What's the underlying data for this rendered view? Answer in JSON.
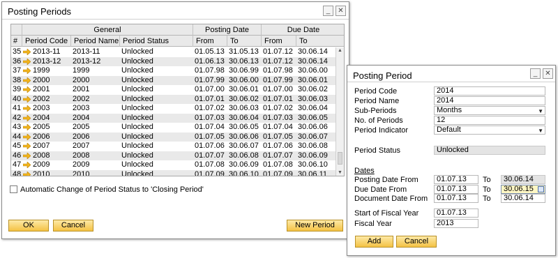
{
  "posting_periods_window": {
    "title": "Posting Periods",
    "grid": {
      "group_headers": {
        "general": "General",
        "posting_date": "Posting Date",
        "due_date": "Due Date"
      },
      "columns": {
        "num": "#",
        "period_code": "Period Code",
        "period_name": "Period Name",
        "period_status": "Period Status",
        "pd_from": "From",
        "pd_to": "To",
        "dd_from": "From",
        "dd_to": "To"
      },
      "rows": [
        {
          "num": "35",
          "code": "2013-11",
          "name": "2013-11",
          "status": "Unlocked",
          "pd_from": "01.05.13",
          "pd_to": "31.05.13",
          "dd_from": "01.07.12",
          "dd_to": "30.06.14"
        },
        {
          "num": "36",
          "code": "2013-12",
          "name": "2013-12",
          "status": "Unlocked",
          "pd_from": "01.06.13",
          "pd_to": "30.06.13",
          "dd_from": "01.07.12",
          "dd_to": "30.06.14"
        },
        {
          "num": "37",
          "code": "1999",
          "name": "1999",
          "status": "Unlocked",
          "pd_from": "01.07.98",
          "pd_to": "30.06.99",
          "dd_from": "01.07.98",
          "dd_to": "30.06.00"
        },
        {
          "num": "38",
          "code": "2000",
          "name": "2000",
          "status": "Unlocked",
          "pd_from": "01.07.99",
          "pd_to": "30.06.00",
          "dd_from": "01.07.99",
          "dd_to": "30.06.01"
        },
        {
          "num": "39",
          "code": "2001",
          "name": "2001",
          "status": "Unlocked",
          "pd_from": "01.07.00",
          "pd_to": "30.06.01",
          "dd_from": "01.07.00",
          "dd_to": "30.06.02"
        },
        {
          "num": "40",
          "code": "2002",
          "name": "2002",
          "status": "Unlocked",
          "pd_from": "01.07.01",
          "pd_to": "30.06.02",
          "dd_from": "01.07.01",
          "dd_to": "30.06.03"
        },
        {
          "num": "41",
          "code": "2003",
          "name": "2003",
          "status": "Unlocked",
          "pd_from": "01.07.02",
          "pd_to": "30.06.03",
          "dd_from": "01.07.02",
          "dd_to": "30.06.04"
        },
        {
          "num": "42",
          "code": "2004",
          "name": "2004",
          "status": "Unlocked",
          "pd_from": "01.07.03",
          "pd_to": "30.06.04",
          "dd_from": "01.07.03",
          "dd_to": "30.06.05"
        },
        {
          "num": "43",
          "code": "2005",
          "name": "2005",
          "status": "Unlocked",
          "pd_from": "01.07.04",
          "pd_to": "30.06.05",
          "dd_from": "01.07.04",
          "dd_to": "30.06.06"
        },
        {
          "num": "44",
          "code": "2006",
          "name": "2006",
          "status": "Unlocked",
          "pd_from": "01.07.05",
          "pd_to": "30.06.06",
          "dd_from": "01.07.05",
          "dd_to": "30.06.07"
        },
        {
          "num": "45",
          "code": "2007",
          "name": "2007",
          "status": "Unlocked",
          "pd_from": "01.07.06",
          "pd_to": "30.06.07",
          "dd_from": "01.07.06",
          "dd_to": "30.06.08"
        },
        {
          "num": "46",
          "code": "2008",
          "name": "2008",
          "status": "Unlocked",
          "pd_from": "01.07.07",
          "pd_to": "30.06.08",
          "dd_from": "01.07.07",
          "dd_to": "30.06.09"
        },
        {
          "num": "47",
          "code": "2009",
          "name": "2009",
          "status": "Unlocked",
          "pd_from": "01.07.08",
          "pd_to": "30.06.09",
          "dd_from": "01.07.08",
          "dd_to": "30.06.10"
        },
        {
          "num": "48",
          "code": "2010",
          "name": "2010",
          "status": "Unlocked",
          "pd_from": "01.07.09",
          "pd_to": "30.06.10",
          "dd_from": "01.07.09",
          "dd_to": "30.06.11"
        }
      ]
    },
    "auto_change_label": "Automatic Change of Period Status to 'Closing Period'",
    "ok_label": "OK",
    "cancel_label": "Cancel",
    "new_period_label": "New Period"
  },
  "posting_period_window": {
    "title": "Posting Period",
    "period_code_label": "Period Code",
    "period_code": "2014",
    "period_name_label": "Period Name",
    "period_name": "2014",
    "sub_periods_label": "Sub-Periods",
    "sub_periods": "Months",
    "no_of_periods_label": "No. of Periods",
    "no_of_periods": "12",
    "period_indicator_label": "Period Indicator",
    "period_indicator": "Default",
    "period_status_label": "Period Status",
    "period_status": "Unlocked",
    "dates_heading": "Dates",
    "to_label": "To",
    "posting_date_from_label": "Posting Date From",
    "posting_date_from": "01.07.13",
    "posting_date_to": "30.06.14",
    "due_date_from_label": "Due Date From",
    "due_date_from": "01.07.13",
    "due_date_to": "30.06.15",
    "document_date_from_label": "Document Date From",
    "document_date_from": "01.07.13",
    "document_date_to": "30.06.14",
    "start_fiscal_year_label": "Start of Fiscal Year",
    "start_fiscal_year": "01.07.13",
    "fiscal_year_label": "Fiscal Year",
    "fiscal_year": "2013",
    "add_label": "Add",
    "cancel_label": "Cancel"
  },
  "colors": {
    "button_yellow": "#f4c244",
    "arrow_orange": "#f2b51d",
    "row_alt": "#e9e9e9",
    "header_gray": "#e9e9e9"
  }
}
